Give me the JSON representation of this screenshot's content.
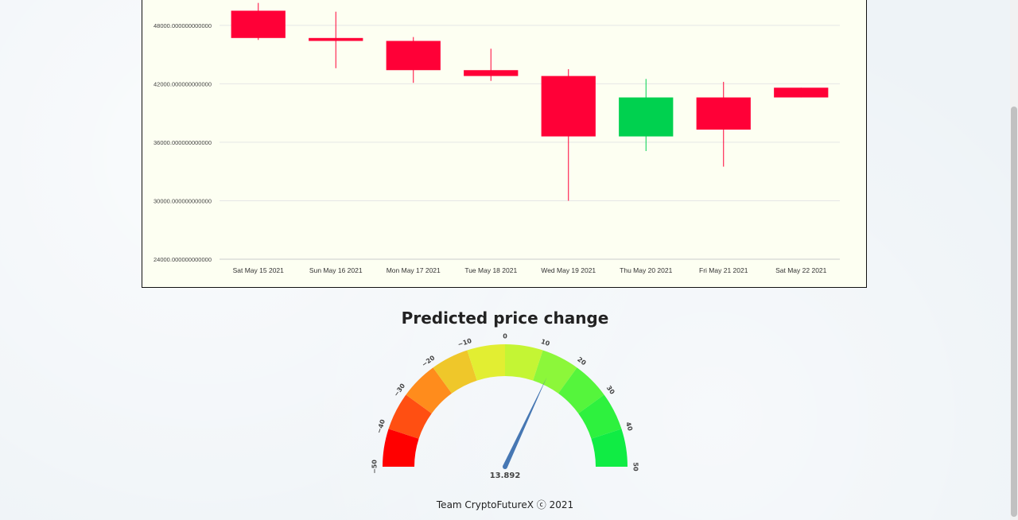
{
  "chart_data": [
    {
      "type": "candlestick",
      "categories": [
        "Sat May 15 2021",
        "Sun May 16 2021",
        "Mon May 17 2021",
        "Tue May 18 2021",
        "Wed May 19 2021",
        "Thu May 20 2021",
        "Fri May 21 2021",
        "Sat May 22 2021"
      ],
      "ohlc": [
        {
          "open": 49500,
          "high": 50300,
          "low": 46500,
          "close": 46700
        },
        {
          "open": 46700,
          "high": 49400,
          "low": 43600,
          "close": 46400
        },
        {
          "open": 46400,
          "high": 46800,
          "low": 42100,
          "close": 43400
        },
        {
          "open": 43400,
          "high": 45600,
          "low": 42300,
          "close": 42800
        },
        {
          "open": 42800,
          "high": 43500,
          "low": 30000,
          "close": 36600
        },
        {
          "open": 36600,
          "high": 42500,
          "low": 35100,
          "close": 40600
        },
        {
          "open": 40600,
          "high": 42200,
          "low": 33500,
          "close": 37300
        },
        {
          "open": 41600,
          "high": 41600,
          "low": 40600,
          "close": 40600
        }
      ],
      "yticks": [
        "48000.000000000000",
        "42000.000000000000",
        "36000.000000000000",
        "30000.000000000000",
        "24000.000000000000"
      ],
      "ytick_values": [
        48000,
        42000,
        36000,
        30000,
        24000
      ],
      "ylim": [
        24000,
        50600
      ],
      "up_color": "#00d14f",
      "down_color": "#ff0037",
      "grid": true
    },
    {
      "type": "gauge",
      "title": "Predicted price change",
      "value": 13.892,
      "value_label": "13.892",
      "range": [
        -50,
        50
      ],
      "ticks": [
        "−50",
        "−40",
        "−30",
        "−20",
        "−10",
        "0",
        "10",
        "20",
        "30",
        "40",
        "50"
      ],
      "tick_values": [
        -50,
        -40,
        -30,
        -20,
        -10,
        0,
        10,
        20,
        30,
        40,
        50
      ],
      "band_colors": [
        "#ff0000",
        "#ff4f12",
        "#ff8c1c",
        "#efc72a",
        "#e2ee32",
        "#c4f534",
        "#8cf73a",
        "#55f53c",
        "#2ef13e",
        "#10ec44"
      ],
      "needle_color": "#4677b3"
    }
  ],
  "footer": {
    "text": "Team CryptoFutureX ⓒ 2021"
  }
}
